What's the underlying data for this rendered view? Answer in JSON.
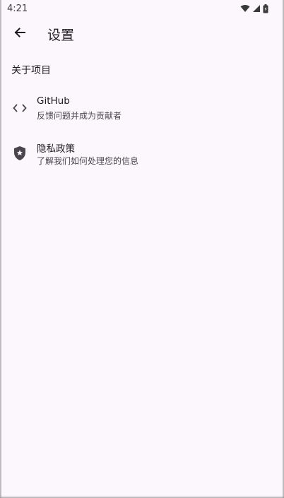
{
  "status_bar": {
    "time": "4:21",
    "icons": [
      "wifi-icon",
      "signal-icon",
      "battery-icon"
    ]
  },
  "app_bar": {
    "back_icon": "arrow-back-icon",
    "title": "设置"
  },
  "section": {
    "header": "关于项目",
    "items": [
      {
        "icon": "code-icon",
        "title": "GitHub",
        "subtitle": "反馈问题并成为贡献者"
      },
      {
        "icon": "shield-star-icon",
        "title": "隐私政策",
        "subtitle": "了解我们如何处理您的信息"
      }
    ]
  },
  "colors": {
    "background": "#fcf7fc",
    "text_primary": "#1d1b20",
    "text_secondary": "#49454f",
    "icon": "#49454f"
  }
}
